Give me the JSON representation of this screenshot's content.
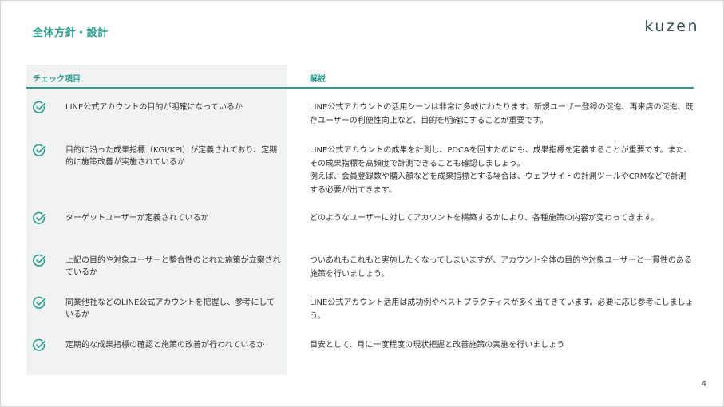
{
  "header": {
    "title": "全体方針・設計",
    "logo_text": "kuzen"
  },
  "table": {
    "col_check_header": "チェック項目",
    "col_desc_header": "解説",
    "check_icon": "check-circle-icon",
    "accent_color": "#2a9d8f",
    "rows": [
      {
        "item": "LINE公式アカウントの目的が明確になっているか",
        "desc": "LINE公式アカウントの活用シーンは非常に多岐にわたります。新規ユーザー登録の促進、再来店の促進、既存ユーザーの利便性向上など、目的を明確にすることが重要です。"
      },
      {
        "item": "目的に沿った成果指標（KGI/KPI）が定義されており、定期的に施策改善が実施されているか",
        "desc": "LINE公式アカウントの成果を計測し、PDCAを回すためにも、成果指標を定義することが重要です。また、その成果指標を高頻度で計測できることも確認しましょう。\n例えば、会員登録数や購入額などを成果指標とする場合は、ウェブサイトの計測ツールやCRMなどで計測する必要が出てきます。"
      },
      {
        "item": "ターゲットユーザーが定義されているか",
        "desc": "どのようなユーザーに対してアカウントを構築するかにより、各種施策の内容が変わってきます。"
      },
      {
        "item": "上記の目的や対象ユーザーと整合性のとれた施策が立案されているか",
        "desc": "ついあれもこれもと実施したくなってしまいますが、アカウント全体の目的や対象ユーザーと一貫性のある施策を行いましょう。"
      },
      {
        "item": "同業他社などのLINE公式アカウントを把握し、参考にしているか",
        "desc": "LINE公式アカウント活用は成功例やベストプラクティスが多く出てきています。必要に応じ参考にしましょう。"
      },
      {
        "item": "定期的な成果指標の確認と施策の改善が行われているか",
        "desc": "目安として、月に一度程度の現状把握と改善施策の実施を行いましょう"
      }
    ]
  },
  "footer": {
    "page_number": "4"
  }
}
